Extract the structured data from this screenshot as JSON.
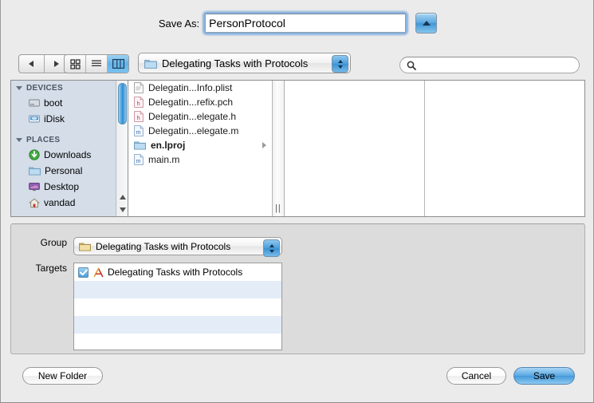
{
  "save_as": {
    "label": "Save As:",
    "value": "PersonProtocol",
    "placeholder": "",
    "collapse_icon": "triangle-up-icon"
  },
  "toolbar": {
    "back_icon": "back-arrow-icon",
    "forward_icon": "forward-arrow-icon",
    "view_modes": [
      {
        "name": "icon-view",
        "icon": "grid-icon",
        "selected": false
      },
      {
        "name": "list-view",
        "icon": "list-icon",
        "selected": false
      },
      {
        "name": "column-view",
        "icon": "columns-icon",
        "selected": true
      }
    ],
    "path_popup": {
      "label": "Delegating Tasks with Protocols",
      "icon": "folder-icon"
    },
    "search": {
      "value": "",
      "placeholder": "",
      "icon": "search-icon"
    }
  },
  "sidebar": {
    "sections": [
      {
        "title": "DEVICES",
        "items": [
          {
            "label": "boot",
            "icon": "hard-drive-icon"
          },
          {
            "label": "iDisk",
            "icon": "idisk-icon"
          }
        ]
      },
      {
        "title": "PLACES",
        "items": [
          {
            "label": "Downloads",
            "icon": "downloads-icon"
          },
          {
            "label": "Personal",
            "icon": "folder-icon"
          },
          {
            "label": "Desktop",
            "icon": "desktop-icon"
          },
          {
            "label": "vandad",
            "icon": "home-icon"
          }
        ]
      }
    ]
  },
  "file_list": [
    {
      "name": "Delegatin...Info.plist",
      "icon": "plist-file-icon",
      "bold": false,
      "has_chevron": false
    },
    {
      "name": "Delegatin...refix.pch",
      "icon": "h-file-icon",
      "bold": false,
      "has_chevron": false
    },
    {
      "name": "Delegatin...elegate.h",
      "icon": "h-file-icon",
      "bold": false,
      "has_chevron": false
    },
    {
      "name": "Delegatin...elegate.m",
      "icon": "m-file-icon",
      "bold": false,
      "has_chevron": false
    },
    {
      "name": "en.lproj",
      "icon": "folder-icon",
      "bold": true,
      "has_chevron": true
    },
    {
      "name": "main.m",
      "icon": "m-file-icon",
      "bold": false,
      "has_chevron": false
    }
  ],
  "accessory": {
    "group": {
      "label": "Group",
      "value": "Delegating Tasks with Protocols",
      "icon": "group-folder-icon"
    },
    "targets": {
      "label": "Targets",
      "rows": [
        {
          "name": "Delegating Tasks with Protocols",
          "checked": true,
          "icon": "target-icon"
        },
        {
          "name": "",
          "checked": false,
          "icon": ""
        },
        {
          "name": "",
          "checked": false,
          "icon": ""
        },
        {
          "name": "",
          "checked": false,
          "icon": ""
        },
        {
          "name": "",
          "checked": false,
          "icon": ""
        }
      ]
    }
  },
  "buttons": {
    "new_folder": "New Folder",
    "cancel": "Cancel",
    "save": "Save"
  },
  "colors": {
    "accent_blue": "#4599da",
    "sidebar_bg": "#d4dde8",
    "chrome_bg": "#ebebeb",
    "stripe_blue": "#e4ecf8"
  }
}
